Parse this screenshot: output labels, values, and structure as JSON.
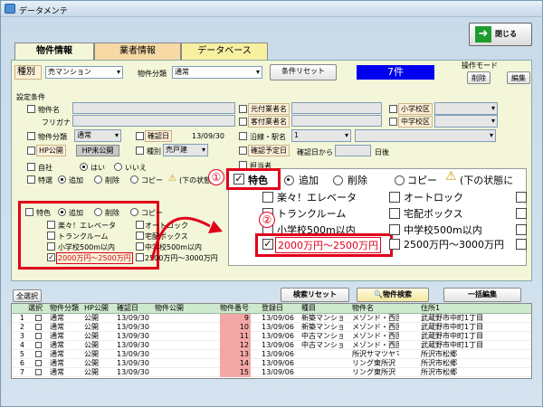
{
  "window": {
    "title": "データメンテ",
    "close_label": "閉じる"
  },
  "tabs": [
    {
      "label": "物件情報"
    },
    {
      "label": "業者情報"
    },
    {
      "label": "データベース"
    }
  ],
  "top": {
    "kind_label": "種別",
    "kind_value": "売マンション",
    "category_label": "物件分類",
    "category_value": "通常",
    "reset_label": "条件リセット",
    "count": "7件",
    "mode_label": "操作モード",
    "delete_label": "削除",
    "edit_label": "編集"
  },
  "cond": {
    "title": "設定条件",
    "name_label": "物件名",
    "furigana_label": "フリガナ",
    "category_label": "物件分類",
    "category_value": "通常",
    "hp_label": "HP公開",
    "hp_value": "HP未公開",
    "confirm_label": "確認日",
    "confirm_date": "13/09/30",
    "kind_label": "種別",
    "kind_value": "売戸建",
    "own_label": "自社",
    "yes_label": "はい",
    "no_label": "いいえ",
    "special_label": "特選",
    "add_label": "追加",
    "del_label": "削除",
    "copy_label": "コピー",
    "copy_note": "(下の状態",
    "agent1_label": "元付業者名",
    "agent2_label": "客付業者名",
    "line_label": "沿線・駅名",
    "line_value": "1",
    "elem_label": "小学校区",
    "middle_label": "中学校区",
    "expire_label": "確認予定日",
    "from_label": "確認日から",
    "days_label": "日後",
    "person_label": "担当者"
  },
  "tokushoku": {
    "label": "特色",
    "add": "追加",
    "del": "削除",
    "copy": "コピー",
    "note": "(下の状態",
    "items": [
      "楽々！エレベータ",
      "トランクルーム",
      "小学校500m以内",
      "2000万円〜2500万円",
      "オートロック",
      "宅配ボックス",
      "中学校500m以内",
      "2500万円〜3000万円"
    ]
  },
  "zoom": {
    "label": "特色",
    "add": "追加",
    "del": "削除",
    "copy": "コピー",
    "note": "(下の状態に",
    "items": [
      "楽々！エレベータ",
      "トランクルーム",
      "小学校500m以内",
      "2000万円〜2500万円",
      "オートロック",
      "宅配ボックス",
      "中学校500m以内",
      "2500万円〜3000万円"
    ]
  },
  "markers": {
    "one": "①",
    "two": "②"
  },
  "bottom": {
    "select_all": "全選択",
    "search_reset": "検索リセット",
    "search": "物件検索",
    "bulk": "一括編集"
  },
  "table": {
    "headers": [
      "選択",
      "物件分類",
      "HP公開",
      "確認日",
      "物件公開",
      "物件番号",
      "登録日",
      "種目",
      "物件名",
      "住所1"
    ],
    "rows": [
      [
        "1",
        "通常",
        "公開",
        "13/09/30",
        "",
        "9",
        "13/09/06",
        "新築マンション",
        "メゾンド・西国",
        "武蔵野市中町1丁目"
      ],
      [
        "2",
        "通常",
        "公開",
        "13/09/30",
        "",
        "10",
        "13/09/06",
        "新築マンション",
        "メゾンド・西国",
        "武蔵野市中町1丁目"
      ],
      [
        "3",
        "通常",
        "公開",
        "13/09/30",
        "",
        "11",
        "13/09/06",
        "中古マンション",
        "メゾンド・西国",
        "武蔵野市中町1丁目"
      ],
      [
        "4",
        "通常",
        "公開",
        "13/09/30",
        "",
        "12",
        "13/09/06",
        "中古マンション",
        "メゾンド・西国",
        "武蔵野市中町1丁目"
      ],
      [
        "5",
        "通常",
        "公開",
        "13/09/30",
        "",
        "13",
        "13/09/06",
        "",
        "所沢サマツヤマンション",
        "所沢市松郷"
      ],
      [
        "6",
        "通常",
        "公開",
        "13/09/30",
        "",
        "14",
        "13/09/06",
        "",
        "リング東所沢",
        "所沢市松郷"
      ],
      [
        "7",
        "通常",
        "公開",
        "13/09/30",
        "",
        "15",
        "13/09/06",
        "",
        "リング東所沢",
        "所沢市松郷"
      ]
    ]
  }
}
